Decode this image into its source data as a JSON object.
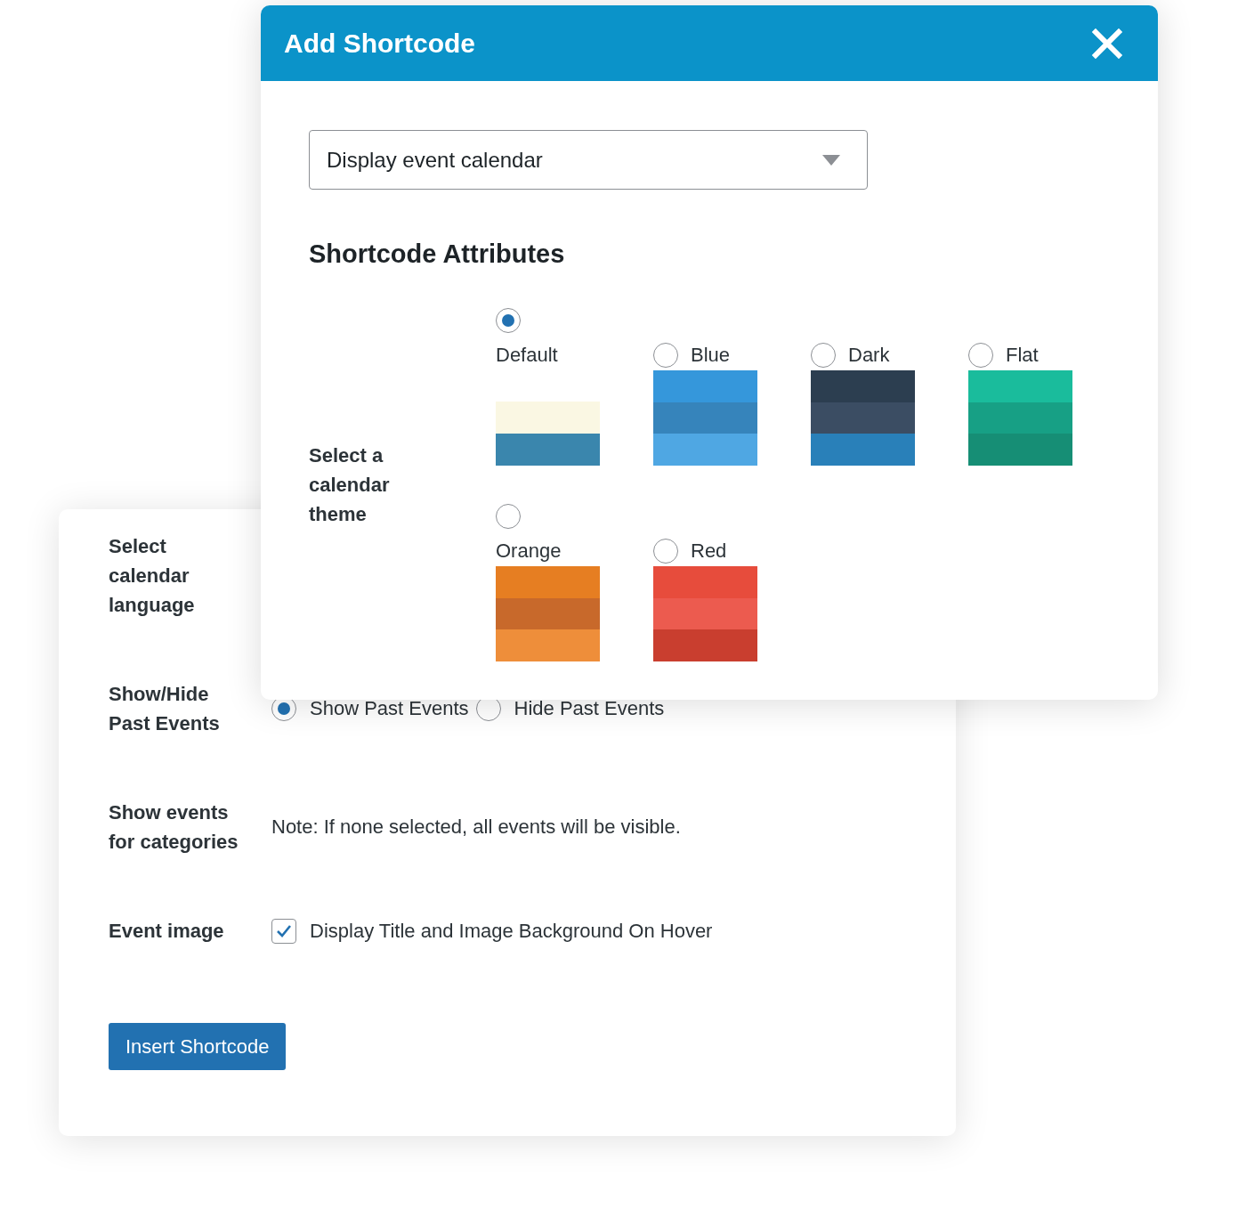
{
  "modal": {
    "title": "Add Shortcode",
    "shortcode_select": {
      "value": "Display event calendar"
    },
    "section_heading": "Shortcode Attributes",
    "theme_field": {
      "label": "Select a\ncalendar\ntheme",
      "themes": [
        {
          "label": "Default",
          "kind": "stacked",
          "selected": true,
          "bands": [
            {
              "color": "#faf7e3"
            },
            {
              "color": "#3a86ad"
            }
          ]
        },
        {
          "label": "Blue",
          "kind": "inline",
          "selected": false,
          "bands": [
            {
              "color": "#3597db"
            },
            {
              "color": "#3684bb"
            },
            {
              "color": "#4fa7e3"
            }
          ]
        },
        {
          "label": "Dark",
          "kind": "inline",
          "selected": false,
          "bands": [
            {
              "color": "#2c3e50"
            },
            {
              "color": "#3b4d63"
            },
            {
              "color": "#2980b9"
            }
          ]
        },
        {
          "label": "Flat",
          "kind": "inline",
          "selected": false,
          "bands": [
            {
              "color": "#1abc9c"
            },
            {
              "color": "#17a085"
            },
            {
              "color": "#168e75"
            }
          ]
        },
        {
          "label": "Orange",
          "kind": "stacked",
          "selected": false,
          "bands": [
            {
              "color": "#e67e22"
            },
            {
              "color": "#c8692b"
            },
            {
              "color": "#ee8e3a"
            }
          ]
        },
        {
          "label": "Red",
          "kind": "inline",
          "selected": false,
          "bands": [
            {
              "color": "#e74c3c"
            },
            {
              "color": "#ec5b4f"
            },
            {
              "color": "#c93e2f"
            }
          ]
        }
      ]
    }
  },
  "settings_panel": {
    "rows": [
      {
        "kind": "label_only",
        "label": "Select\ncalendar\nlanguage"
      },
      {
        "kind": "radios",
        "label": "Show/Hide\nPast Events",
        "options": [
          {
            "label": "Show Past Events",
            "selected": true
          },
          {
            "label": "Hide Past Events",
            "selected": false
          }
        ]
      },
      {
        "kind": "note",
        "label": "Show events\nfor categories",
        "note": "Note: If none selected, all events will be visible."
      },
      {
        "kind": "checkbox",
        "label": "Event image",
        "checkbox": {
          "label": "Display Title and Image Background On Hover",
          "checked": true
        }
      }
    ],
    "button": "Insert Shortcode"
  }
}
